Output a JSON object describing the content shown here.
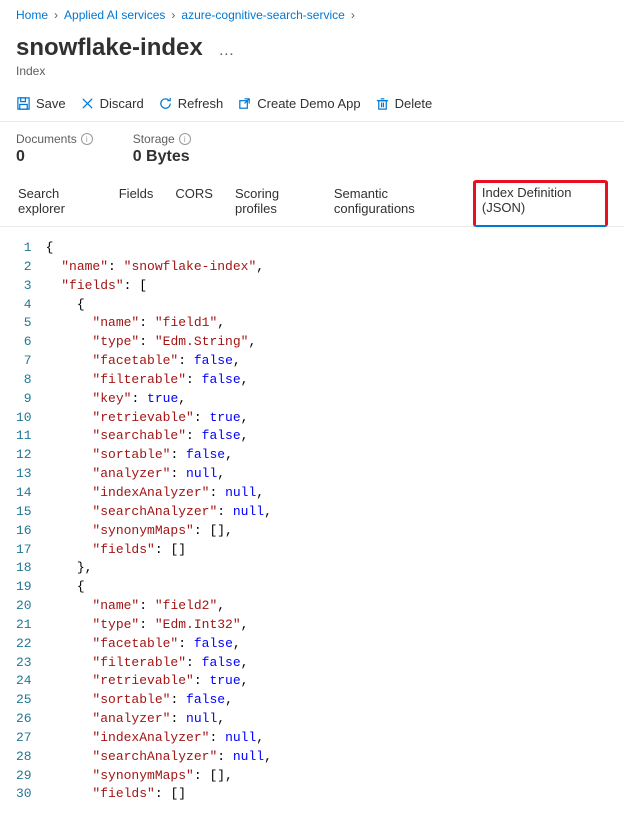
{
  "breadcrumb": [
    {
      "label": "Home"
    },
    {
      "label": "Applied AI services"
    },
    {
      "label": "azure-cognitive-search-service"
    }
  ],
  "title": "snowflake-index",
  "subtitle": "Index",
  "toolbar": {
    "save": "Save",
    "discard": "Discard",
    "refresh": "Refresh",
    "demo": "Create Demo App",
    "delete": "Delete"
  },
  "stats": {
    "documents_label": "Documents",
    "documents_value": "0",
    "storage_label": "Storage",
    "storage_value": "0 Bytes"
  },
  "tabs": {
    "t0": "Search explorer",
    "t1": "Fields",
    "t2": "CORS",
    "t3": "Scoring profiles",
    "t4": "Semantic configurations",
    "t5": "Index Definition (JSON)"
  },
  "code": [
    [
      [
        "p",
        "{"
      ]
    ],
    [
      [
        "p",
        "  "
      ],
      [
        "k",
        "\"name\""
      ],
      [
        "p",
        ": "
      ],
      [
        "k",
        "\"snowflake-index\""
      ],
      [
        "p",
        ","
      ]
    ],
    [
      [
        "p",
        "  "
      ],
      [
        "k",
        "\"fields\""
      ],
      [
        "p",
        ": ["
      ]
    ],
    [
      [
        "p",
        "    {"
      ]
    ],
    [
      [
        "p",
        "      "
      ],
      [
        "k",
        "\"name\""
      ],
      [
        "p",
        ": "
      ],
      [
        "k",
        "\"field1\""
      ],
      [
        "p",
        ","
      ]
    ],
    [
      [
        "p",
        "      "
      ],
      [
        "k",
        "\"type\""
      ],
      [
        "p",
        ": "
      ],
      [
        "k",
        "\"Edm.String\""
      ],
      [
        "p",
        ","
      ]
    ],
    [
      [
        "p",
        "      "
      ],
      [
        "k",
        "\"facetable\""
      ],
      [
        "p",
        ": "
      ],
      [
        "b",
        "false"
      ],
      [
        "p",
        ","
      ]
    ],
    [
      [
        "p",
        "      "
      ],
      [
        "k",
        "\"filterable\""
      ],
      [
        "p",
        ": "
      ],
      [
        "b",
        "false"
      ],
      [
        "p",
        ","
      ]
    ],
    [
      [
        "p",
        "      "
      ],
      [
        "k",
        "\"key\""
      ],
      [
        "p",
        ": "
      ],
      [
        "b",
        "true"
      ],
      [
        "p",
        ","
      ]
    ],
    [
      [
        "p",
        "      "
      ],
      [
        "k",
        "\"retrievable\""
      ],
      [
        "p",
        ": "
      ],
      [
        "b",
        "true"
      ],
      [
        "p",
        ","
      ]
    ],
    [
      [
        "p",
        "      "
      ],
      [
        "k",
        "\"searchable\""
      ],
      [
        "p",
        ": "
      ],
      [
        "b",
        "false"
      ],
      [
        "p",
        ","
      ]
    ],
    [
      [
        "p",
        "      "
      ],
      [
        "k",
        "\"sortable\""
      ],
      [
        "p",
        ": "
      ],
      [
        "b",
        "false"
      ],
      [
        "p",
        ","
      ]
    ],
    [
      [
        "p",
        "      "
      ],
      [
        "k",
        "\"analyzer\""
      ],
      [
        "p",
        ": "
      ],
      [
        "nl",
        "null"
      ],
      [
        "p",
        ","
      ]
    ],
    [
      [
        "p",
        "      "
      ],
      [
        "k",
        "\"indexAnalyzer\""
      ],
      [
        "p",
        ": "
      ],
      [
        "nl",
        "null"
      ],
      [
        "p",
        ","
      ]
    ],
    [
      [
        "p",
        "      "
      ],
      [
        "k",
        "\"searchAnalyzer\""
      ],
      [
        "p",
        ": "
      ],
      [
        "nl",
        "null"
      ],
      [
        "p",
        ","
      ]
    ],
    [
      [
        "p",
        "      "
      ],
      [
        "k",
        "\"synonymMaps\""
      ],
      [
        "p",
        ": [],"
      ]
    ],
    [
      [
        "p",
        "      "
      ],
      [
        "k",
        "\"fields\""
      ],
      [
        "p",
        ": []"
      ]
    ],
    [
      [
        "p",
        "    },"
      ]
    ],
    [
      [
        "p",
        "    {"
      ]
    ],
    [
      [
        "p",
        "      "
      ],
      [
        "k",
        "\"name\""
      ],
      [
        "p",
        ": "
      ],
      [
        "k",
        "\"field2\""
      ],
      [
        "p",
        ","
      ]
    ],
    [
      [
        "p",
        "      "
      ],
      [
        "k",
        "\"type\""
      ],
      [
        "p",
        ": "
      ],
      [
        "k",
        "\"Edm.Int32\""
      ],
      [
        "p",
        ","
      ]
    ],
    [
      [
        "p",
        "      "
      ],
      [
        "k",
        "\"facetable\""
      ],
      [
        "p",
        ": "
      ],
      [
        "b",
        "false"
      ],
      [
        "p",
        ","
      ]
    ],
    [
      [
        "p",
        "      "
      ],
      [
        "k",
        "\"filterable\""
      ],
      [
        "p",
        ": "
      ],
      [
        "b",
        "false"
      ],
      [
        "p",
        ","
      ]
    ],
    [
      [
        "p",
        "      "
      ],
      [
        "k",
        "\"retrievable\""
      ],
      [
        "p",
        ": "
      ],
      [
        "b",
        "true"
      ],
      [
        "p",
        ","
      ]
    ],
    [
      [
        "p",
        "      "
      ],
      [
        "k",
        "\"sortable\""
      ],
      [
        "p",
        ": "
      ],
      [
        "b",
        "false"
      ],
      [
        "p",
        ","
      ]
    ],
    [
      [
        "p",
        "      "
      ],
      [
        "k",
        "\"analyzer\""
      ],
      [
        "p",
        ": "
      ],
      [
        "nl",
        "null"
      ],
      [
        "p",
        ","
      ]
    ],
    [
      [
        "p",
        "      "
      ],
      [
        "k",
        "\"indexAnalyzer\""
      ],
      [
        "p",
        ": "
      ],
      [
        "nl",
        "null"
      ],
      [
        "p",
        ","
      ]
    ],
    [
      [
        "p",
        "      "
      ],
      [
        "k",
        "\"searchAnalyzer\""
      ],
      [
        "p",
        ": "
      ],
      [
        "nl",
        "null"
      ],
      [
        "p",
        ","
      ]
    ],
    [
      [
        "p",
        "      "
      ],
      [
        "k",
        "\"synonymMaps\""
      ],
      [
        "p",
        ": [],"
      ]
    ],
    [
      [
        "p",
        "      "
      ],
      [
        "k",
        "\"fields\""
      ],
      [
        "p",
        ": []"
      ]
    ]
  ]
}
